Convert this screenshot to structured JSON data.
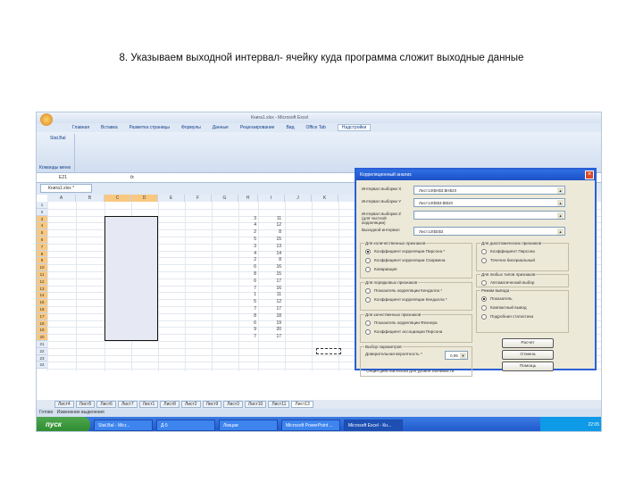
{
  "caption": "8. Указываем выходной интервал- ячейку куда программа сложит выходные данные",
  "window": {
    "title": "Книга1.xlsx - Microsoft Excel"
  },
  "ribbon": {
    "tabs": [
      "Главная",
      "Вставка",
      "Разметка страницы",
      "Формулы",
      "Данные",
      "Рецензирование",
      "Вид",
      "Office Tab",
      "Надстройки"
    ],
    "active": 8,
    "group_item": "Stat.Bal",
    "group_label": "Команды меню"
  },
  "formula_bar": {
    "name_box": "E21",
    "fx": "fx"
  },
  "doc_tab": "Книга1.xlsx *",
  "columns": [
    "A",
    "B",
    "C",
    "D",
    "E",
    "F",
    "G",
    "H",
    "I",
    "J",
    "K"
  ],
  "rows": [
    1,
    2,
    3,
    4,
    5,
    6,
    7,
    8,
    9,
    10,
    11,
    12,
    13,
    14,
    15,
    16,
    17,
    18,
    19,
    20,
    21,
    22,
    23,
    24
  ],
  "data": {
    "H": [
      3,
      4,
      2,
      5,
      3,
      4,
      2,
      6,
      8,
      6,
      7,
      1,
      5,
      7,
      8,
      6,
      9,
      7
    ],
    "I": [
      11,
      12,
      8,
      15,
      13,
      14,
      8,
      16,
      15,
      17,
      16,
      11,
      12,
      17,
      18,
      19,
      20,
      17
    ]
  },
  "sheet_tabs": [
    "Лист4",
    "Лист5",
    "Лист6",
    "Лист7",
    "Лист1",
    "Лист8",
    "Лист2",
    "Лист9",
    "Лист3",
    "Лист10",
    "Лист11",
    "Лист13"
  ],
  "status": {
    "ready": "Готово",
    "text": "Изменение выделения"
  },
  "taskbar": {
    "start": "пуск",
    "items": [
      "Stat.Bal - Micr...",
      "Д-5",
      "Лекции",
      "Microsoft PowerPoint ...",
      "Microsoft Excel - Кн..."
    ],
    "active": 4,
    "clock": "22:05"
  },
  "dialog": {
    "title": "Корреляционный анализ",
    "fields": [
      {
        "label": "Интервал выборки X",
        "value": "Лист13!$H$3:$H$20"
      },
      {
        "label": "Интервал выборки Y",
        "value": "Лист13!$I$3:$I$20"
      },
      {
        "label": "Интервал выборки Z (для частной корреляции)",
        "value": ""
      },
      {
        "label": "Выходной интервал",
        "value": "Лист13!$D$3"
      }
    ],
    "groups": [
      {
        "title": "Для количественных признаков",
        "options": [
          "Коэффициент корреляции Пирсона *",
          "Коэффициент корреляции Спирмена",
          "Ковариация"
        ],
        "selected": 0
      },
      {
        "title": "Для порядковых признаков",
        "options": [
          "Показатель корреляции Кендалла *",
          "Коэффициент корреляции Кендалла *"
        ]
      },
      {
        "title": "Для качественных признаков",
        "options": [
          "Показатель корреляции Фехнера",
          "Коэффициент ассоциации Пирсона"
        ]
      },
      {
        "title": "Для дихотомических признаков",
        "options": [
          "Коэффициент Пирсона",
          "Точечно-бисериальный"
        ]
      },
      {
        "title": "Для любых типов признаков",
        "options": [
          "Автоматический выбор"
        ]
      },
      {
        "title": "Режим вывода",
        "options": [
          "Показатель",
          "Компактный вывод",
          "Подробная статистика"
        ],
        "selected": 0
      }
    ],
    "params": {
      "title": "Выбор параметров",
      "label": "Доверительная вероятность *",
      "value": "0,95"
    },
    "footnote": "* Опция действительна для уровня значимости",
    "buttons": [
      "Расчет",
      "Отмена",
      "Помощь"
    ]
  }
}
